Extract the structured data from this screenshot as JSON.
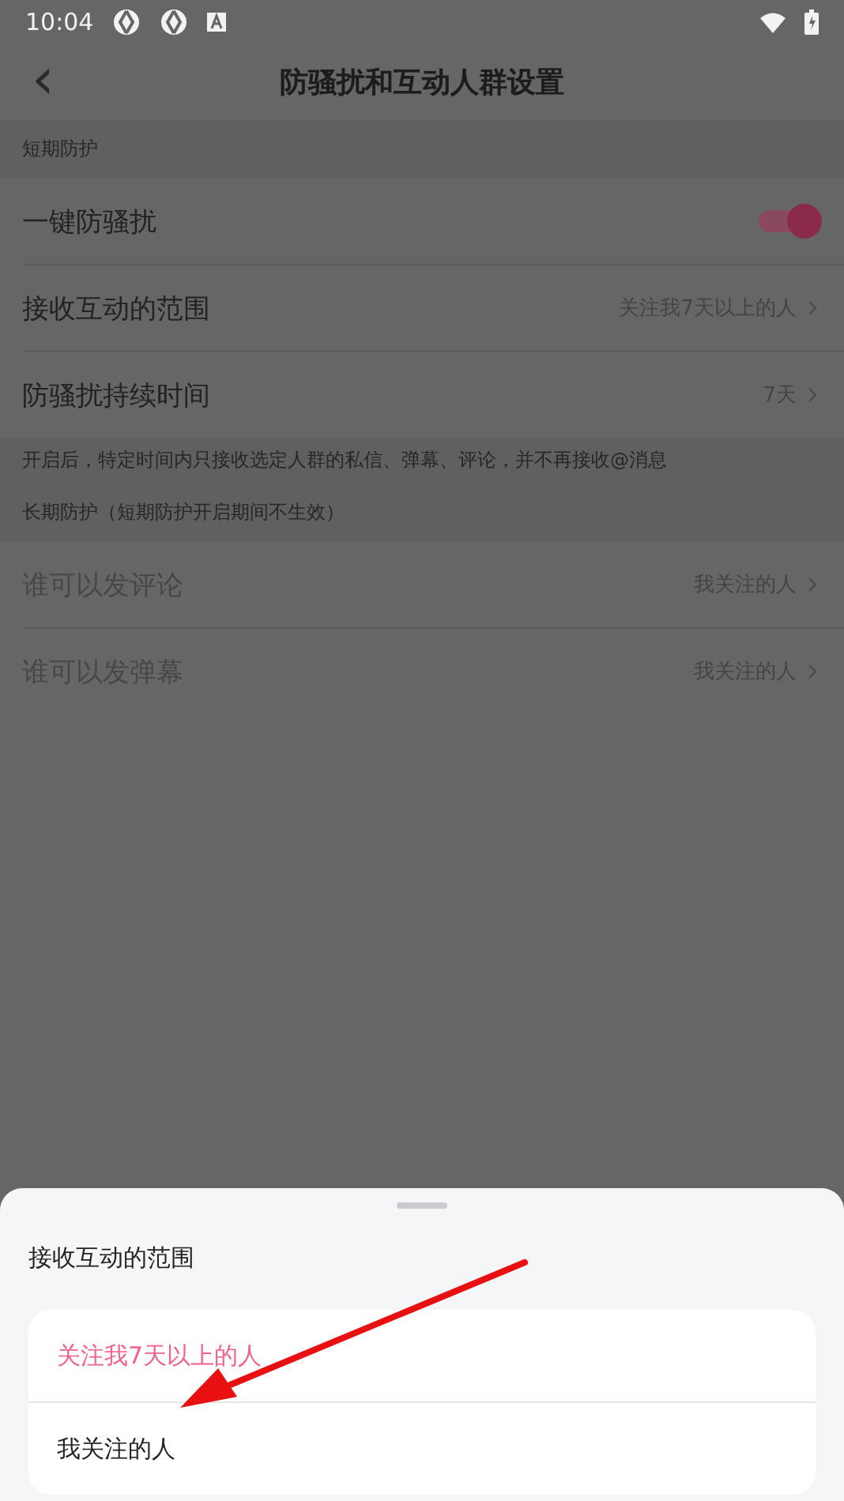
{
  "status_bar": {
    "time": "10:04"
  },
  "header": {
    "back": "‹",
    "title": "防骚扰和互动人群设置"
  },
  "sections": [
    {
      "label": "短期防护",
      "rows": [
        {
          "kind": "toggle",
          "label": "一键防骚扰",
          "on": true,
          "disabled": false
        },
        {
          "kind": "link",
          "label": "接收互动的范围",
          "value": "关注我7天以上的人",
          "disabled": false
        },
        {
          "kind": "link",
          "label": "防骚扰持续时间",
          "value": "7天",
          "disabled": false
        }
      ],
      "note": "开启后，特定时间内只接收选定人群的私信、弹幕、评论，并不再接收@消息"
    },
    {
      "label": "长期防护（短期防护开启期间不生效）",
      "rows": [
        {
          "kind": "link",
          "label": "谁可以发评论",
          "value": "我关注的人",
          "disabled": true
        },
        {
          "kind": "link",
          "label": "谁可以发弹幕",
          "value": "我关注的人",
          "disabled": true
        }
      ]
    }
  ],
  "sheet": {
    "title": "接收互动的范围",
    "options": [
      {
        "label": "关注我7天以上的人",
        "selected": true
      },
      {
        "label": "我关注的人",
        "selected": false
      }
    ]
  }
}
